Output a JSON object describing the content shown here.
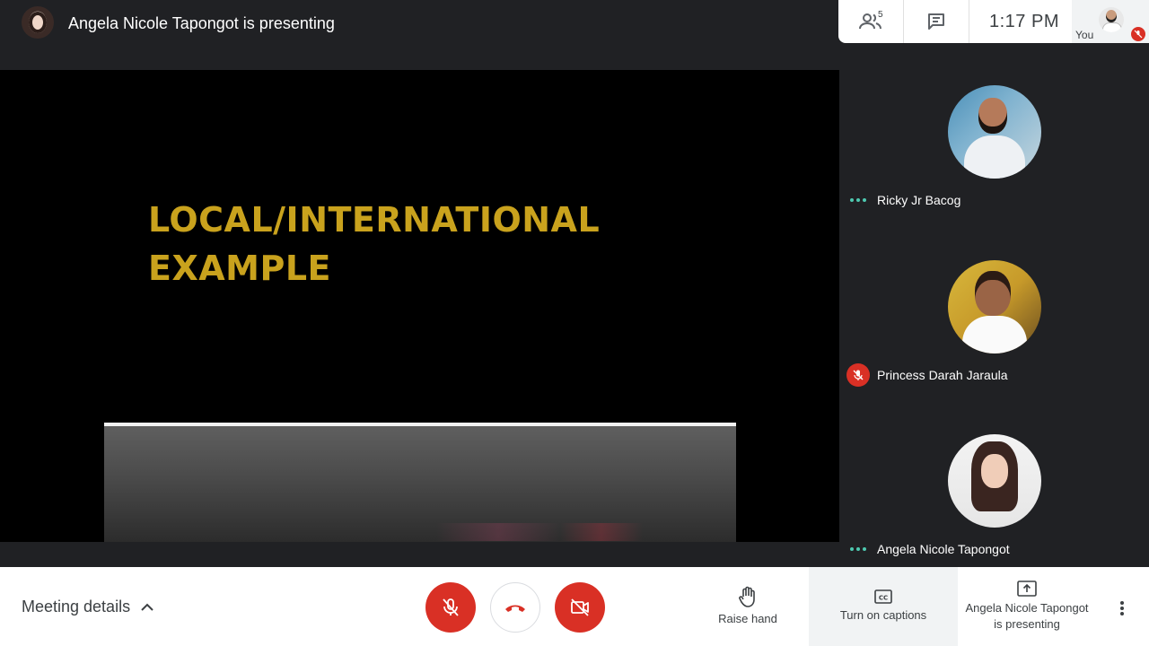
{
  "presenter": {
    "banner": "Angela Nicole Tapongot is presenting"
  },
  "slide": {
    "title_line1": "LOCAL/INTERNATIONAL",
    "title_line2": "EXAMPLE"
  },
  "top_panel": {
    "people_count": "5",
    "time": "1:17  PM",
    "self_label": "You"
  },
  "participants": [
    {
      "name": "Ricky Jr Bacog",
      "status": "speaking-dots"
    },
    {
      "name": "Princess Darah Jaraula",
      "status": "muted"
    },
    {
      "name": "Angela Nicole Tapongot",
      "status": "speaking-dots"
    }
  ],
  "controls": {
    "meeting_details": "Meeting details",
    "raise_hand": "Raise hand",
    "turn_on_captions": "Turn on captions",
    "presenting_line1": "Angela Nicole Tapongot",
    "presenting_line2": "is presenting"
  },
  "colors": {
    "accent_red": "#d93025",
    "slide_title": "#c9a21d",
    "speaking_dots": "#4ec9b0"
  },
  "icons": {
    "people": "people-icon",
    "chat": "chat-icon",
    "mic_off": "mic-off-icon",
    "hang_up": "hang-up-icon",
    "camera_off": "camera-off-icon",
    "raise_hand": "hand-icon",
    "captions": "cc-icon",
    "present": "present-icon",
    "more": "more-vert-icon",
    "chevron": "chevron-up-icon"
  }
}
